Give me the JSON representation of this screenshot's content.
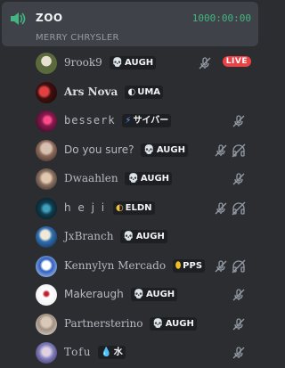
{
  "channel": {
    "name": "ZOO",
    "timer": "1000:00:00",
    "status": "MERRY CHRYSLER",
    "accent": "#43b581"
  },
  "users": [
    {
      "name": "9rook9",
      "badge_icon": "skull-icon",
      "badge": "AUGH",
      "live": "LIVE",
      "muted": true,
      "deafened": false
    },
    {
      "name": "Ars Nova",
      "badge_icon": "moon-icon",
      "badge": "UMA",
      "muted": false,
      "deafened": false
    },
    {
      "name": "besserk",
      "badge_icon": "lightning-icon",
      "badge": "サイバー",
      "muted": true,
      "deafened": false
    },
    {
      "name": "Do you sure?",
      "badge_icon": "skull-icon",
      "badge": "AUGH",
      "muted": true,
      "deafened": true
    },
    {
      "name": "Dwaahlen",
      "badge_icon": "skull-icon",
      "badge": "AUGH",
      "muted": true,
      "deafened": false
    },
    {
      "name": "h e j i",
      "badge_icon": "moon-icon",
      "badge": "ELDN",
      "muted": true,
      "deafened": true
    },
    {
      "name": "JxBranch",
      "badge_icon": "skull-icon",
      "badge": "AUGH",
      "muted": false,
      "deafened": false
    },
    {
      "name": "Kennylyn Mercado",
      "badge_icon": "pill-icon",
      "badge": "PPS",
      "muted": true,
      "deafened": true
    },
    {
      "name": "Makeraugh",
      "badge_icon": "skull-icon",
      "badge": "AUGH",
      "muted": true,
      "deafened": false
    },
    {
      "name": "Partnersterino",
      "badge_icon": "skull-icon",
      "badge": "AUGH",
      "muted": true,
      "deafened": false
    },
    {
      "name": "Tofu",
      "badge_icon": "droplet-icon",
      "badge": "水",
      "muted": true,
      "deafened": false
    }
  ]
}
